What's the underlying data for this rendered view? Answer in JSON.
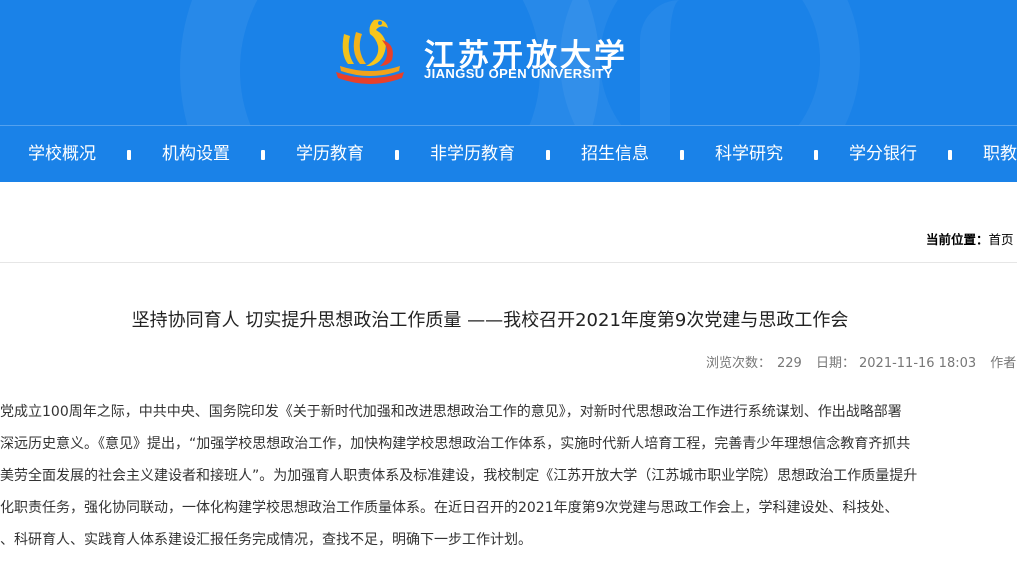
{
  "header": {
    "logo_cn": "江苏开放大学",
    "logo_en": "JIANGSU OPEN UNIVERSITY",
    "brand_color": "#1a82e8"
  },
  "nav": {
    "items": [
      "学校概况",
      "机构设置",
      "学历教育",
      "非学历教育",
      "招生信息",
      "科学研究",
      "学分银行",
      "职教"
    ]
  },
  "breadcrumb": {
    "label": "当前位置：",
    "home": "首页"
  },
  "article": {
    "title": "坚持协同育人 切实提升思想政治工作质量 ——我校召开2021年度第9次党建与思政工作会",
    "views_label": "浏览次数：",
    "views": "229",
    "date_label": "日期：",
    "date": "2021-11-16 18:03",
    "author_label": "作者",
    "lines": [
      "党成立100周年之际，中共中央、国务院印发《关于新时代加强和改进思想政治工作的意见》，对新时代思想政治工作进行系统谋划、作出战略部署",
      "深远历史意义。《意见》提出，“加强学校思想政治工作，加快构建学校思想政治工作体系，实施时代新人培育工程，完善青少年理想信念教育齐抓共",
      "美劳全面发展的社会主义建设者和接班人”。为加强育人职责体系及标准建设，我校制定《江苏开放大学（江苏城市职业学院）思想政治工作质量提升",
      "化职责任务，强化协同联动，一体化构建学校思想政治工作质量体系。在近日召开的2021年度第9次党建与思政工作会上，学科建设处、科技处、",
      "、科研育人、实践育人体系建设汇报任务完成情况，查找不足，明确下一步工作计划。"
    ]
  }
}
